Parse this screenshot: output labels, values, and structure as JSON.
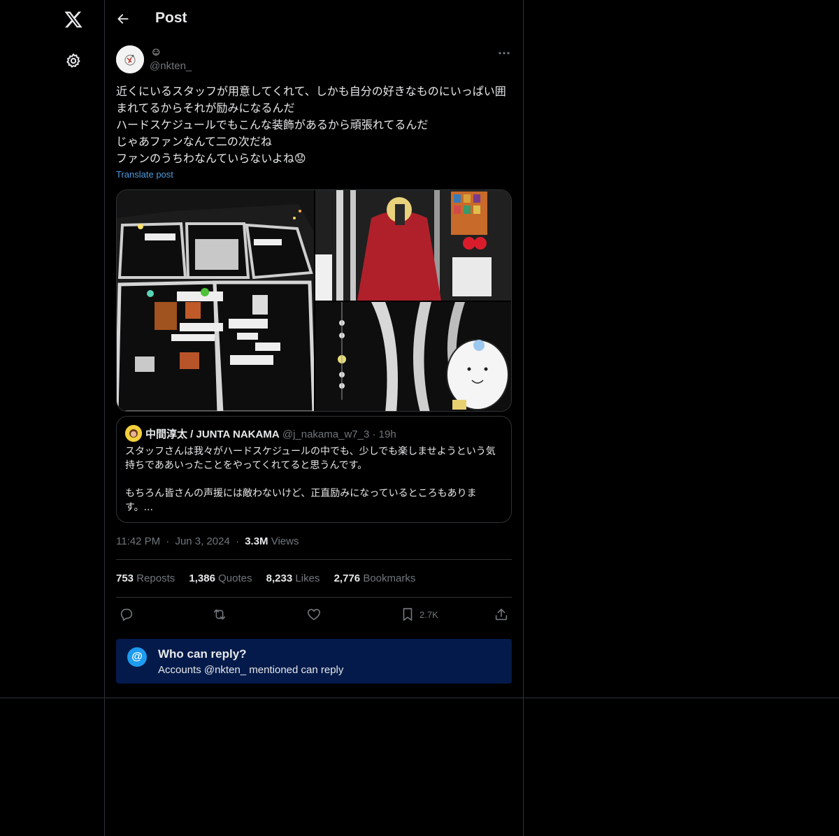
{
  "header": {
    "title": "Post"
  },
  "sidebar": {
    "logo_icon": "x-logo-icon",
    "settings_icon": "gear-icon"
  },
  "post": {
    "display_name": "☺",
    "handle": "@nkten_",
    "text": "近くにいるスタッフが用意してくれて、しかも自分の好きなものにいっぱい囲まれてるからそれが励みになるんだ\nハードスケジュールでもこんな装飾があるから頑張れてるんだ\nじゃあファンなんて二の次だね\nファンのうちわなんていらないよね😟",
    "translate_label": "Translate post",
    "media_count": 3
  },
  "quote": {
    "name": "中間淳太 / JUNTA NAKAMA",
    "handle": "@j_nakama_w7_3",
    "dot": "·",
    "time": "19h",
    "text": "スタッフさんは我々がハードスケジュールの中でも、少しでも楽しませようという気持ちでああいったことをやってくれてると思うんです。\n\nもちろん皆さんの声援には敵わないけど、正直励みになっているところもあります。..."
  },
  "meta": {
    "time": "11:42 PM",
    "dot1": "·",
    "date": "Jun 3, 2024",
    "dot2": "·",
    "views_count": "3.3M",
    "views_label": "Views"
  },
  "stats": {
    "reposts_count": "753",
    "reposts_label": "Reposts",
    "quotes_count": "1,386",
    "quotes_label": "Quotes",
    "likes_count": "8,233",
    "likes_label": "Likes",
    "bookmarks_count": "2,776",
    "bookmarks_label": "Bookmarks"
  },
  "actions": {
    "bookmark_count": "2.7K"
  },
  "reply_settings": {
    "icon": "@",
    "title": "Who can reply?",
    "subtitle": "Accounts @nkten_ mentioned can reply"
  },
  "colors": {
    "background": "#000000",
    "border": "#2f3336",
    "text_primary": "#e7e9ea",
    "text_secondary": "#71767b",
    "link": "#4e9cdf",
    "reply_box": "#031a4a",
    "accent": "#1d9bf0"
  }
}
